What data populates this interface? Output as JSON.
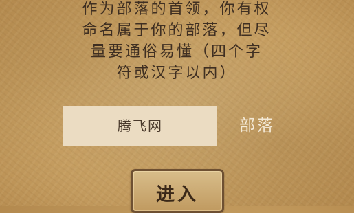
{
  "instructions": {
    "line1": "作为部落的首领，你有权",
    "line2": "命名属于你的部落，但尽",
    "line3": "量要通俗易懂（四个字",
    "line4": "符或汉字以内）"
  },
  "name_input": {
    "value": "腾飞网"
  },
  "suffix": "部落",
  "enter_button_label": "进入",
  "colors": {
    "parchment": "#c9a265",
    "input_bg": "#ebdcc2",
    "text_dark": "#3f2f22",
    "suffix_text": "#f4ead7",
    "button_border": "#6e5032"
  }
}
